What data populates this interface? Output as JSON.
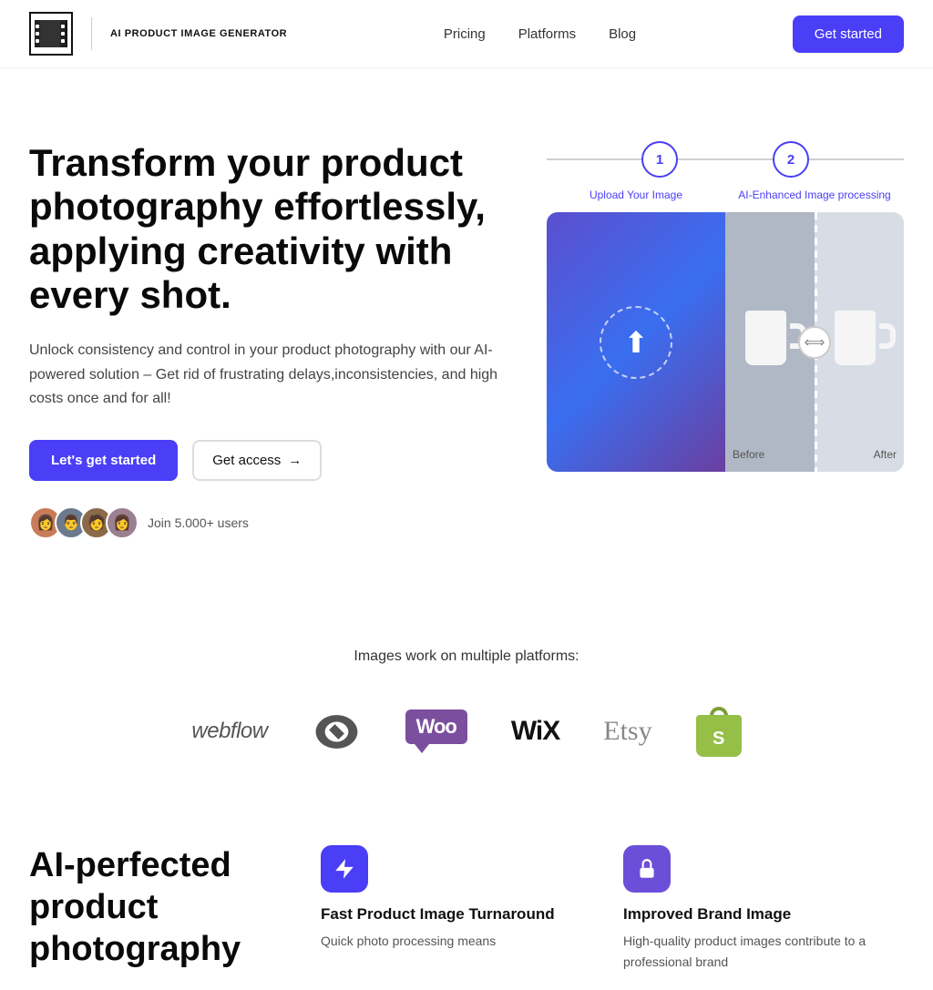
{
  "nav": {
    "brand": "AI PRODUCT IMAGE GENERATOR",
    "links": [
      "Pricing",
      "Platforms",
      "Blog"
    ],
    "cta": "Get started"
  },
  "hero": {
    "title": "Transform your product photography effortlessly, applying creativity with every shot.",
    "description": "Unlock consistency and control in your product photography with our AI-powered solution – Get rid of frustrating delays,inconsistencies, and high costs once and for all!",
    "btn_primary": "Let's get started",
    "btn_secondary": "Get access",
    "btn_secondary_arrow": "→",
    "join_text": "Join 5.000+ users",
    "step1_label": "Upload Your Image",
    "step2_label": "AI-Enhanced Image processing",
    "step1_num": "1",
    "step2_num": "2",
    "before_label": "Before",
    "after_label": "After"
  },
  "platforms": {
    "label": "Images work on multiple platforms:",
    "items": [
      "webflow",
      "squarespace",
      "woocommerce",
      "wix",
      "etsy",
      "shopify"
    ]
  },
  "features": {
    "section_title": "AI-perfected product photography",
    "card1": {
      "title": "Fast Product Image Turnaround",
      "desc": "Quick photo processing means"
    },
    "card2": {
      "title": "Improved Brand Image",
      "desc": "High-quality product images contribute to a professional brand"
    }
  }
}
